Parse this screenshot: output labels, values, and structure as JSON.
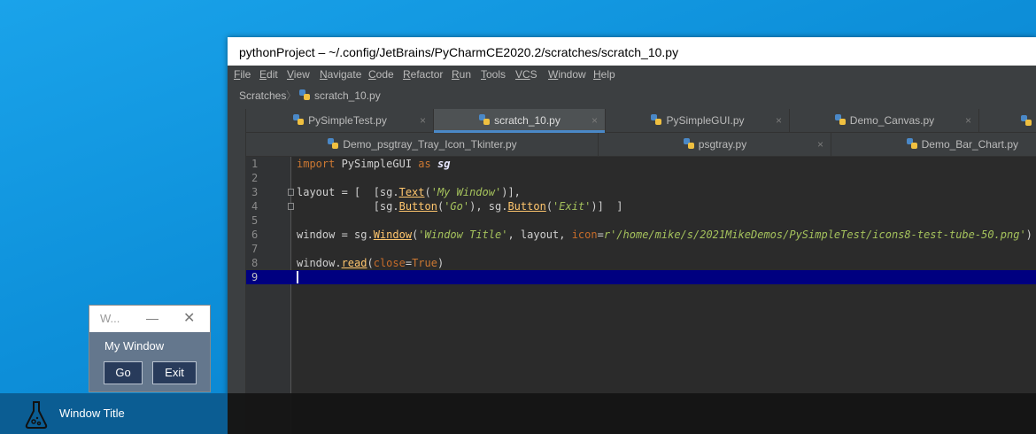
{
  "ide": {
    "title": "pythonProject – ~/.config/JetBrains/PyCharmCE2020.2/scratches/scratch_10.py",
    "menu": [
      {
        "u": "F",
        "rest": "ile"
      },
      {
        "u": "E",
        "rest": "dit"
      },
      {
        "u": "V",
        "rest": "iew"
      },
      {
        "u": "N",
        "rest": "avigate"
      },
      {
        "u": "C",
        "rest": "ode"
      },
      {
        "u": "R",
        "rest": "efactor"
      },
      {
        "u": "R",
        "rest": "un"
      },
      {
        "u": "T",
        "rest": "ools"
      },
      {
        "u": "VC",
        "rest": "S"
      },
      {
        "u": "W",
        "rest": "indow"
      },
      {
        "u": "H",
        "rest": "elp"
      }
    ],
    "breadcrumb": {
      "root": "Scratches",
      "file": "scratch_10.py"
    },
    "tabs_row1": [
      "PySimpleTest.py",
      "scratch_10.py",
      "PySimpleGUI.py",
      "Demo_Canvas.py"
    ],
    "tabs_row2": [
      "Demo_psgtray_Tray_Icon_Tkinter.py",
      "psgtray.py",
      "Demo_Bar_Chart.py"
    ],
    "close_glyph": "×",
    "breadcrumb_sep": "〉",
    "line_numbers": [
      "1",
      "2",
      "3",
      "4",
      "5",
      "6",
      "7",
      "8",
      "9"
    ],
    "code": {
      "l1": {
        "kw1": "import",
        "mod": " PySimpleGUI ",
        "kw2": "as",
        "alias": "sg"
      },
      "l3": {
        "a": "layout = [  [sg.",
        "fn": "Text",
        "b": "(",
        "s": "'My Window'",
        "c": ")],"
      },
      "l4": {
        "a": "            [sg.",
        "fn1": "Button",
        "b": "(",
        "s1": "'Go'",
        "c": "), sg.",
        "fn2": "Button",
        "d": "(",
        "s2": "'Exit'",
        "e": ")]  ]"
      },
      "l6": {
        "a": "window = sg.",
        "fn": "Window",
        "b": "(",
        "s1": "'Window Title'",
        "c": ", layout, ",
        "p": "icon",
        "eq": "=",
        "s2": "r'/home/mike/s/2021MikeDemos/PySimpleTest/icons8-test-tube-50.png'",
        "d": ")"
      },
      "l8": {
        "a": "window.",
        "fn": "read",
        "b": "(",
        "p": "close",
        "eq": "=",
        "v": "True",
        "c": ")"
      }
    },
    "colors": {
      "accent": "#4a88c7",
      "current_line": "#000080"
    }
  },
  "taskbar": {
    "app_label": "Window Title",
    "app_icon": "test-tube-icon"
  },
  "mini_window": {
    "title": "W...",
    "minimize_glyph": "—",
    "close_glyph": "✕",
    "text": "My Window",
    "buttons": [
      "Go",
      "Exit"
    ],
    "colors": {
      "background": "#64778d",
      "button": "#283b5b"
    }
  }
}
